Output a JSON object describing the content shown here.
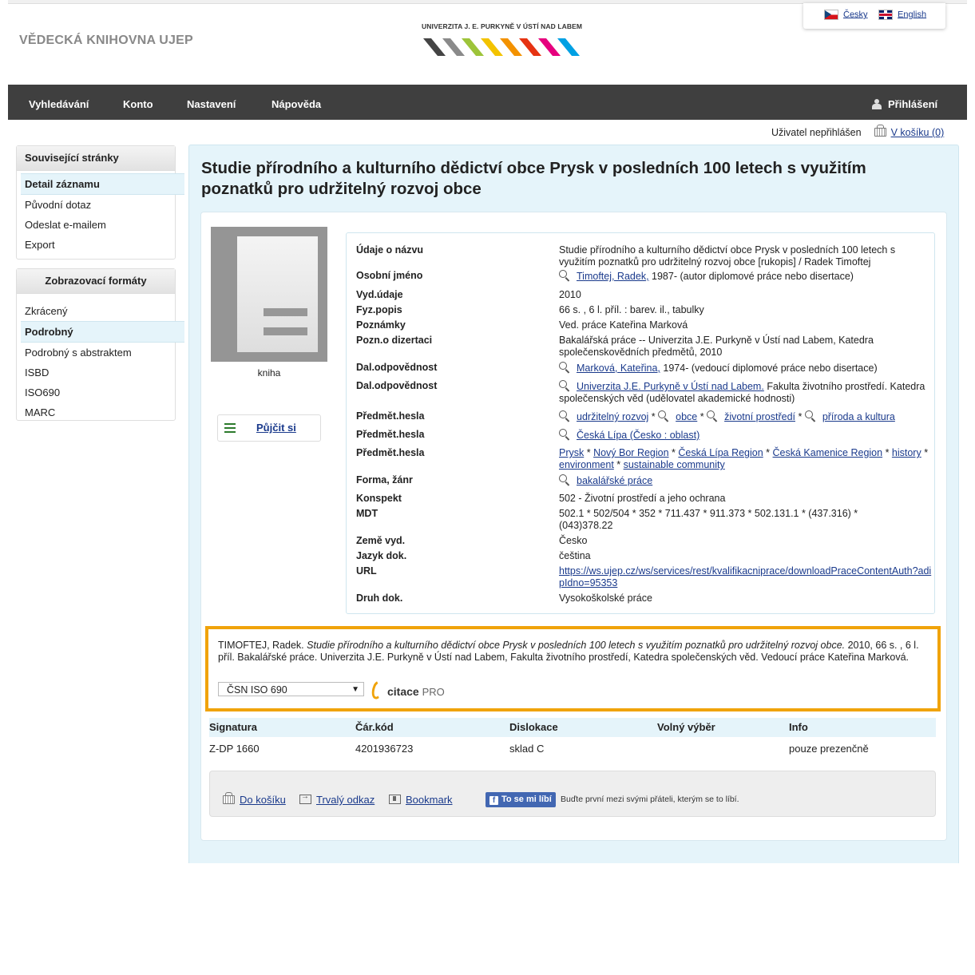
{
  "header": {
    "site_title": "VĚDECKÁ KNIHOVNA UJEP",
    "logo_text": "UNIVERZITA J. E. PURKYNĚ V ÚSTÍ NAD LABEM",
    "logo_colors": [
      "#444444",
      "#8a8a8a",
      "#9dc43a",
      "#f3c300",
      "#f39200",
      "#e63312",
      "#e6007e",
      "#00a0e3"
    ],
    "lang_cz": "Česky",
    "lang_en": "English"
  },
  "nav": {
    "items": [
      "Vyhledávání",
      "Konto",
      "Nastavení",
      "Nápověda"
    ],
    "login": "Přihlášení"
  },
  "userbar": {
    "status": "Uživatel nepřihlášen",
    "basket": "V košíku (0)"
  },
  "sidebar": {
    "related_title": "Související stránky",
    "related_items": [
      "Detail záznamu",
      "Původní dotaz",
      "Odeslat e-mailem",
      "Export"
    ],
    "formats_title": "Zobrazovací formáty",
    "format_items": [
      "Zkrácený",
      "Podrobný",
      "Podrobný s abstraktem",
      "ISBD",
      "ISO690",
      "MARC"
    ]
  },
  "record": {
    "title": "Studie přírodního a kulturního dědictví obce Prysk v posledních 100 letech s využitím poznatků pro udržitelný rozvoj obce",
    "cover_label": "kniha",
    "borrow_label": "Půjčit si",
    "fields": {
      "title_label": "Údaje o názvu",
      "title_value": "Studie přírodního a kulturního dědictví obce Prysk v posledních 100 letech s využitím poznatků pro udržitelný rozvoj obce [rukopis] / Radek Timoftej",
      "author_label": "Osobní jméno",
      "author_link": "Timoftej, Radek,",
      "author_rest": "1987- (autor diplomové práce nebo disertace)",
      "pub_label": "Vyd.údaje",
      "pub_value": "2010",
      "phys_label": "Fyz.popis",
      "phys_value": "66 s. , 6 l. příl. : barev. il., tabulky",
      "notes_label": "Poznámky",
      "notes_value": "Ved. práce Kateřina Marková",
      "thesis_label": "Pozn.o dizertaci",
      "thesis_value": "Bakalářská práce -- Univerzita J.E. Purkyně v Ústí nad Labem, Katedra společenskovědních předmětů, 2010",
      "resp1_label": "Dal.odpovědnost",
      "resp1_link": "Marková, Kateřina,",
      "resp1_rest": "1974- (vedoucí diplomové práce nebo disertace)",
      "resp2_label": "Dal.odpovědnost",
      "resp2_link": "Univerzita J.E. Purkyně v Ústí nad Labem.",
      "resp2_rest": "Fakulta životního prostředí. Katedra společenských věd (udělovatel akademické hodnosti)",
      "subj1_label": "Předmět.hesla",
      "subj1_links": [
        "udržitelný rozvoj",
        "obce",
        "životní prostředí",
        "příroda a kultura"
      ],
      "subj2_label": "Předmět.hesla",
      "subj2_link": "Česká Lípa (Česko : oblast)",
      "subj3_label": "Předmět.hesla",
      "subj3_links": [
        "Prysk",
        "Nový Bor Region",
        "Česká Lípa Region",
        "Česká Kamenice Region",
        "history",
        "environment",
        "sustainable community"
      ],
      "genre_label": "Forma, žánr",
      "genre_link": "bakalářské práce",
      "konspekt_label": "Konspekt",
      "konspekt_value": "502 - Životní prostředí a jeho ochrana",
      "mdt_label": "MDT",
      "mdt_value": "502.1 * 502/504 * 352 * 711.437 * 911.373 * 502.131.1 * (437.316) * (043)378.22",
      "country_label": "Země vyd.",
      "country_value": "Česko",
      "lang_label": "Jazyk dok.",
      "lang_value": "čeština",
      "url_label": "URL",
      "url_value": "https://ws.ujep.cz/ws/services/rest/kvalifikacniprace/downloadPraceContentAuth?adipIdno=95353",
      "type_label": "Druh dok.",
      "type_value": "Vysokoškolské práce"
    }
  },
  "citation": {
    "author": "TIMOFTEJ, Radek.",
    "title": "Studie přírodního a kulturního dědictví obce Prysk v posledních 100 letech s využitím poznatků pro udržitelný rozvoj obce.",
    "rest": "2010, 66 s. , 6 l. příl. Bakalářské práce. Univerzita J.E. Purkyně v Ústí nad Labem, Fakulta životního prostředí, Katedra společenských věd. Vedoucí práce Kateřina Marková.",
    "style": "ČSN ISO 690",
    "logo_main": "citace",
    "logo_pro": "PRO",
    "accent": "#f0a30a"
  },
  "holdings": {
    "headers": [
      "Signatura",
      "Čár.kód",
      "Dislokace",
      "Volný výběr",
      "Info"
    ],
    "row": [
      "Z-DP 1660",
      "4201936723",
      "sklad C",
      "",
      "pouze prezenčně"
    ]
  },
  "actions": {
    "basket": "Do košíku",
    "permalink": "Trvalý odkaz",
    "bookmark": "Bookmark",
    "fb_button": "To se mi líbí",
    "fb_text": "Buďte první mezi svými přáteli, kterým se to líbí."
  }
}
